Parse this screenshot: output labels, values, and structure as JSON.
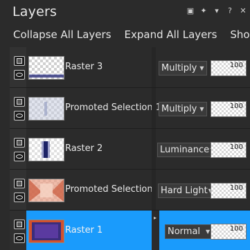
{
  "panel": {
    "title": "Layers",
    "title_icons": [
      "restore-icon",
      "pin-icon",
      "dropdown-icon",
      "help-icon",
      "close-icon"
    ]
  },
  "toolbar": {
    "collapse": "Collapse All Layers",
    "expand": "Expand All Layers",
    "show_hide": "Show/Hid"
  },
  "layers": [
    {
      "name": "Raster 3",
      "blend": "Multiply",
      "opacity": "100"
    },
    {
      "name": "Promoted Selection 1",
      "blend": "Multiply",
      "opacity": "100"
    },
    {
      "name": "Raster 2",
      "blend": "Luminance",
      "opacity": "100"
    },
    {
      "name": "Promoted Selection",
      "blend": "Hard Light",
      "opacity": "100"
    },
    {
      "name": "Raster 1",
      "blend": "Normal",
      "opacity": "100",
      "selected": true
    }
  ],
  "colors": {
    "background": "#2b2b2b",
    "selection": "#1a9bfc",
    "text": "#e8e8e8"
  }
}
